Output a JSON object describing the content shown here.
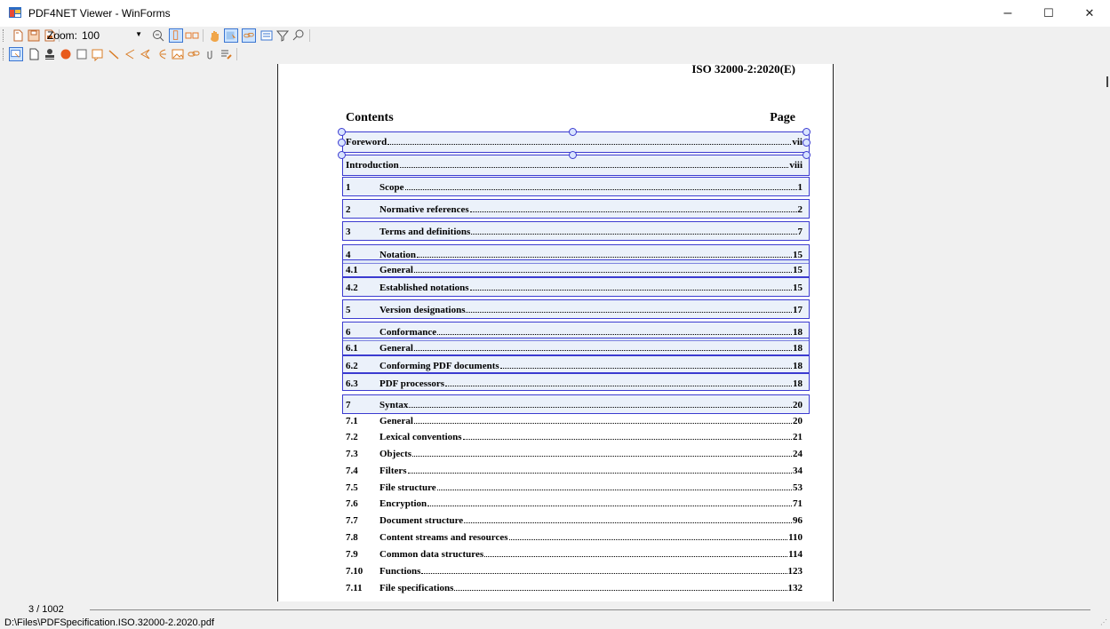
{
  "window": {
    "title": "PDF4NET Viewer - WinForms",
    "minimize_glyph": "–",
    "maximize_glyph": "☐",
    "close_glyph": "✕"
  },
  "toolbar1": {
    "zoom_label": "Zoom:",
    "zoom_value": "100",
    "icons": [
      "open-icon",
      "save-icon",
      "save-as-icon",
      "zoom-in-icon",
      "single-page-icon",
      "two-page-icon",
      "pan-hand-icon",
      "select-text-icon",
      "link-icon",
      "form-icon",
      "filter-icon",
      "search-icon"
    ]
  },
  "toolbar2": {
    "icons": [
      "select-annotation-icon",
      "page-icon",
      "stamp-icon",
      "circle-icon",
      "square-icon",
      "note-icon",
      "line-icon",
      "polyline-icon",
      "polygon-icon",
      "ink-icon",
      "image-icon",
      "link-annotation-icon",
      "attachment-icon",
      "highlight-icon"
    ]
  },
  "document": {
    "header": "ISO 32000-2:2020(E)",
    "contents_heading": "Contents",
    "page_heading": "Page",
    "entries": [
      {
        "num": "",
        "title": "Foreword",
        "page": "vii"
      },
      {
        "num": "",
        "title": "Introduction",
        "page": "viii"
      },
      {
        "num": "1",
        "title": "Scope",
        "page": "1"
      },
      {
        "num": "2",
        "title": "Normative references",
        "page": "2"
      },
      {
        "num": "3",
        "title": "Terms and definitions",
        "page": "7"
      },
      {
        "num": "4",
        "title": "Notation",
        "page": "15"
      },
      {
        "num": "4.1",
        "title": "General",
        "page": "15"
      },
      {
        "num": "4.2",
        "title": "Established notations",
        "page": "15"
      },
      {
        "num": "5",
        "title": "Version designations",
        "page": "17"
      },
      {
        "num": "6",
        "title": "Conformance",
        "page": "18"
      },
      {
        "num": "6.1",
        "title": "General",
        "page": "18"
      },
      {
        "num": "6.2",
        "title": "Conforming PDF documents",
        "page": "18"
      },
      {
        "num": "6.3",
        "title": "PDF processors",
        "page": "18"
      },
      {
        "num": "7",
        "title": "Syntax",
        "page": "20"
      },
      {
        "num": "7.1",
        "title": "General",
        "page": "20"
      },
      {
        "num": "7.2",
        "title": "Lexical conventions",
        "page": "21"
      },
      {
        "num": "7.3",
        "title": "Objects",
        "page": "24"
      },
      {
        "num": "7.4",
        "title": "Filters",
        "page": "34"
      },
      {
        "num": "7.5",
        "title": "File structure",
        "page": "53"
      },
      {
        "num": "7.6",
        "title": "Encryption",
        "page": "71"
      },
      {
        "num": "7.7",
        "title": "Document structure",
        "page": "96"
      },
      {
        "num": "7.8",
        "title": "Content streams and resources",
        "page": "110"
      },
      {
        "num": "7.9",
        "title": "Common data structures",
        "page": "114"
      },
      {
        "num": "7.10",
        "title": "Functions",
        "page": "123"
      },
      {
        "num": "7.11",
        "title": "File specifications",
        "page": "132"
      }
    ]
  },
  "status": {
    "page_indicator": "3 / 1002",
    "file_path": "D:\\Files\\PDFSpecification.ISO.32000-2.2020.pdf"
  },
  "colors": {
    "link_border": "#3b3bd0",
    "link_fill": "#d2e1f5",
    "accent": "#3a75d1"
  }
}
